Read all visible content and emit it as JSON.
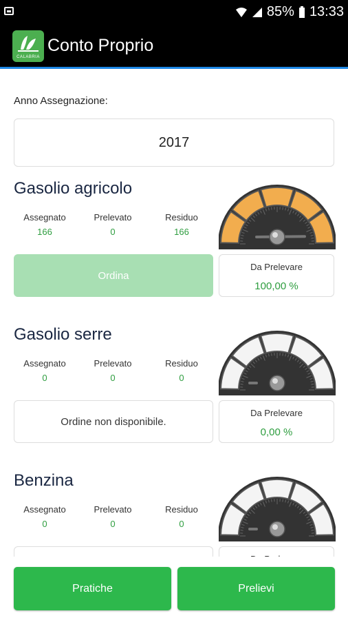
{
  "status_bar": {
    "battery": "85%",
    "time": "13:33",
    "icons": [
      "wifi-icon",
      "signal-icon",
      "battery-icon",
      "notification-icon"
    ]
  },
  "app": {
    "title": "Conto Proprio",
    "logo_text": "CALABRIA"
  },
  "year": {
    "label": "Anno Assegnazione:",
    "value": "2017"
  },
  "labels": {
    "assigned": "Assegnato",
    "withdrawn": "Prelevato",
    "residual": "Residuo",
    "to_withdraw": "Da Prelevare"
  },
  "sections": [
    {
      "title": "Gasolio agricolo",
      "assigned": "166",
      "withdrawn": "0",
      "residual": "166",
      "action": "Ordina",
      "percent": "100,00 %",
      "gauge_fill_color": "#f2ad4e",
      "gauge_level": 1.0
    },
    {
      "title": "Gasolio serre",
      "assigned": "0",
      "withdrawn": "0",
      "residual": "0",
      "action": "Ordine non disponibile.",
      "percent": "0,00 %",
      "gauge_fill_color": "#ffffff",
      "gauge_level": 0.0
    },
    {
      "title": "Benzina",
      "assigned": "0",
      "withdrawn": "0",
      "residual": "0",
      "action": "",
      "percent": "",
      "gauge_fill_color": "#ffffff",
      "gauge_level": 0.0
    }
  ],
  "bottom": {
    "left_button": "Pratiche",
    "right_button": "Prelievi"
  },
  "colors": {
    "accent_green": "#2db84c",
    "value_green": "#2e9d3f",
    "appbar_line": "#1e88e5"
  }
}
